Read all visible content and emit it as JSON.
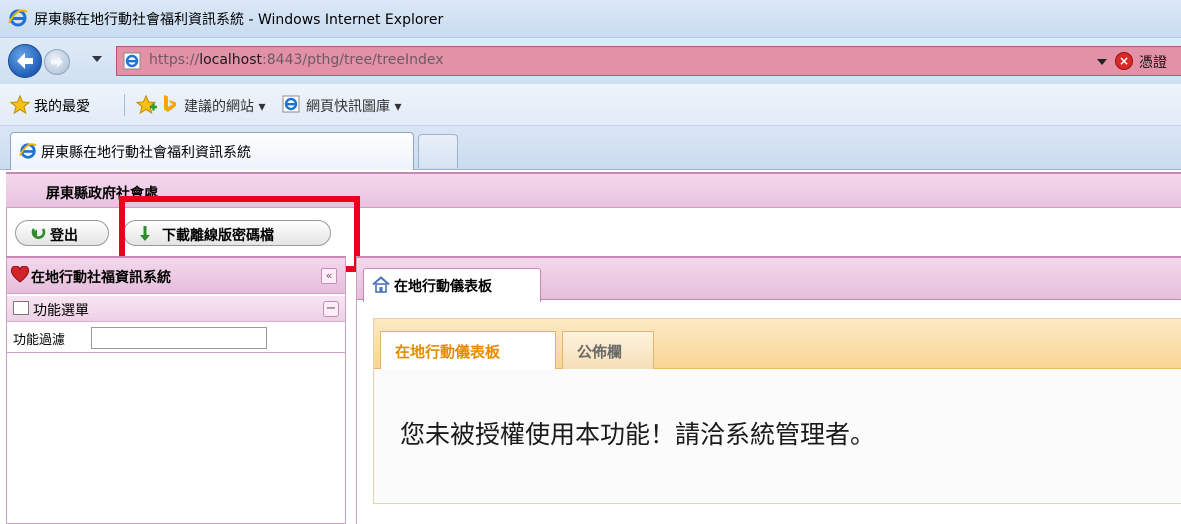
{
  "window": {
    "title": "屏東縣在地行動社會福利資訊系統 - Windows Internet Explorer"
  },
  "address_bar": {
    "url_prefix": "https://",
    "url_host": "localhost",
    "url_rest": ":8443/pthg/tree/treeIndex",
    "cert_text": "憑證",
    "bar_color": "#e391a6"
  },
  "favorites_bar": {
    "favorites_label": "我的最愛",
    "suggested_sites": "建議的網站 ▾",
    "web_slice": "網頁快訊圖庫 ▾"
  },
  "browser_tab": {
    "title": "屏東縣在地行動社會福利資訊系統"
  },
  "app": {
    "org_name": "屏東縣政府社會處",
    "toolbar": {
      "logout_label": "登出",
      "download_label": "下載離線版密碼檔"
    },
    "left_panel": {
      "title": "在地行動社福資訊系統",
      "collapse_symbol": "«",
      "menu_label": "功能選單",
      "minus_symbol": "−",
      "filter_label": "功能過濾",
      "filter_value": ""
    },
    "right_panel": {
      "tab_label": "在地行動儀表板",
      "inner_tabs": [
        {
          "label": "在地行動儀表板"
        },
        {
          "label": "公佈欄"
        }
      ],
      "message": "您未被授權使用本功能！請洽系統管理者。"
    }
  },
  "colors": {
    "highlight": "#e8001c",
    "active_tab_text": "#e68a00",
    "panel_pink": "#f3d8ec"
  }
}
